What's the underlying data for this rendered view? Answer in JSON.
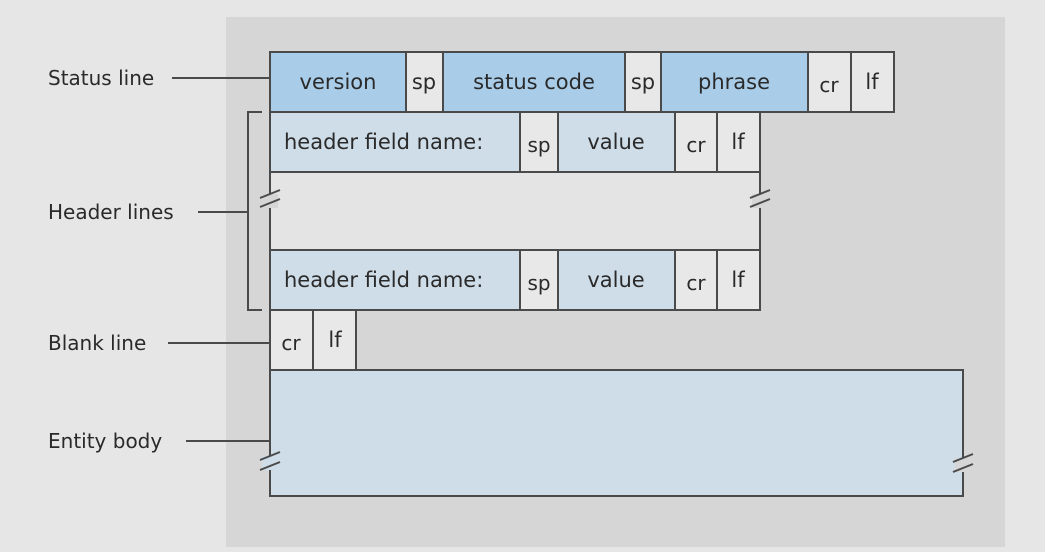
{
  "labels": {
    "status_line": "Status line",
    "header_lines": "Header lines",
    "blank_line": "Blank line",
    "entity_body": "Entity body"
  },
  "status_line": {
    "version": "version",
    "sp1": "sp",
    "status_code": "status code",
    "sp2": "sp",
    "phrase": "phrase",
    "cr": "cr",
    "lf": "lf"
  },
  "header_lines": [
    {
      "name": "header field name:",
      "sp": "sp",
      "value": "value",
      "cr": "cr",
      "lf": "lf"
    },
    {
      "name": "header field name:",
      "sp": "sp",
      "value": "value",
      "cr": "cr",
      "lf": "lf"
    }
  ],
  "blank_line": {
    "cr": "cr",
    "lf": "lf"
  },
  "colors": {
    "background": "#e6e6e6",
    "panel": "#d6d6d6",
    "status_field": "#a9cde9",
    "header_field": "#cfdde8",
    "separator_cell": "#e8e8e8",
    "stroke": "#4a4a4a"
  }
}
